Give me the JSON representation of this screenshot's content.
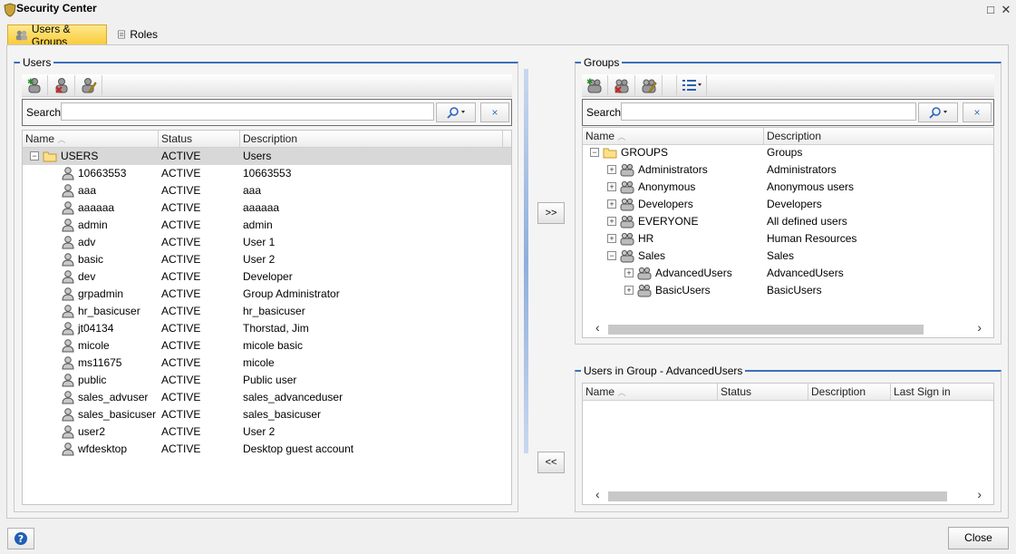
{
  "window": {
    "title": "Security Center",
    "maximize_label": "□",
    "close_label": "✕"
  },
  "tabs": [
    {
      "label": "Users & Groups",
      "active": true
    },
    {
      "label": "Roles",
      "active": false
    }
  ],
  "users_panel": {
    "legend": "Users",
    "search_label": "Search:",
    "search_value": "",
    "clear_label": "×",
    "columns": [
      "Name",
      "Status",
      "Description"
    ],
    "root": {
      "name": "USERS",
      "status": "ACTIVE",
      "description": "Users"
    },
    "rows": [
      {
        "name": "10663553",
        "status": "ACTIVE",
        "description": "10663553"
      },
      {
        "name": "aaa",
        "status": "ACTIVE",
        "description": "aaa"
      },
      {
        "name": "aaaaaa",
        "status": "ACTIVE",
        "description": "aaaaaa"
      },
      {
        "name": "admin",
        "status": "ACTIVE",
        "description": "admin"
      },
      {
        "name": "adv",
        "status": "ACTIVE",
        "description": "User 1"
      },
      {
        "name": "basic",
        "status": "ACTIVE",
        "description": "User 2"
      },
      {
        "name": "dev",
        "status": "ACTIVE",
        "description": "Developer"
      },
      {
        "name": "grpadmin",
        "status": "ACTIVE",
        "description": "Group Administrator"
      },
      {
        "name": "hr_basicuser",
        "status": "ACTIVE",
        "description": "hr_basicuser"
      },
      {
        "name": "jt04134",
        "status": "ACTIVE",
        "description": "Thorstad, Jim"
      },
      {
        "name": "micole",
        "status": "ACTIVE",
        "description": "micole basic"
      },
      {
        "name": "ms11675",
        "status": "ACTIVE",
        "description": "micole"
      },
      {
        "name": "public",
        "status": "ACTIVE",
        "description": "Public user"
      },
      {
        "name": "sales_advuser",
        "status": "ACTIVE",
        "description": "sales_advanceduser"
      },
      {
        "name": "sales_basicuser",
        "status": "ACTIVE",
        "description": "sales_basicuser"
      },
      {
        "name": "user2",
        "status": "ACTIVE",
        "description": "User 2"
      },
      {
        "name": "wfdesktop",
        "status": "ACTIVE",
        "description": "Desktop guest account"
      }
    ]
  },
  "transfer": {
    "add_label": ">>",
    "remove_label": "<<"
  },
  "groups_panel": {
    "legend": "Groups",
    "search_label": "Search:",
    "search_value": "",
    "clear_label": "×",
    "columns": [
      "Name",
      "Description"
    ],
    "root": {
      "name": "GROUPS",
      "description": "Groups"
    },
    "rows": [
      {
        "name": "Administrators",
        "description": "Administrators",
        "expander": "+"
      },
      {
        "name": "Anonymous",
        "description": "Anonymous users",
        "expander": "+"
      },
      {
        "name": "Developers",
        "description": "Developers",
        "expander": "+"
      },
      {
        "name": "EVERYONE",
        "description": "All defined users",
        "expander": "+"
      },
      {
        "name": "HR",
        "description": "Human Resources",
        "expander": "+"
      },
      {
        "name": "Sales",
        "description": "Sales",
        "expander": "−"
      },
      {
        "name": "AdvancedUsers",
        "description": "AdvancedUsers",
        "expander": "+",
        "child": true
      },
      {
        "name": "BasicUsers",
        "description": "BasicUsers",
        "expander": "+",
        "child": true
      }
    ]
  },
  "members_panel": {
    "legend": "Users in Group - AdvancedUsers",
    "columns": [
      "Name",
      "Status",
      "Description",
      "Last Sign in"
    ]
  },
  "footer": {
    "help_label": "?",
    "close_label": "Close"
  },
  "colors": {
    "accent": "#3d6fb8",
    "tab_active": "#f9cc3c",
    "help": "#1f5fb4"
  }
}
